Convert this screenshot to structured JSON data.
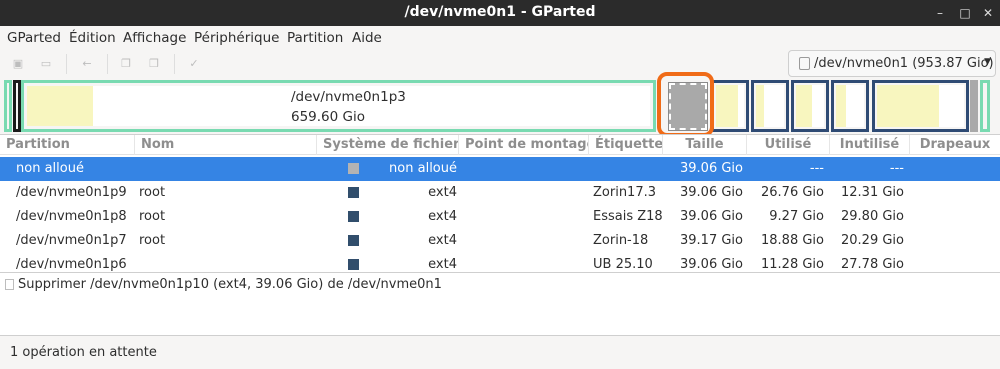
{
  "window": {
    "title": "/dev/nvme0n1 - GParted"
  },
  "menubar": [
    "GParted",
    "Édition",
    "Affichage",
    "Périphérique",
    "Partition",
    "Aide"
  ],
  "device_selector": {
    "label": "/dev/nvme0n1 (953.87 Gio)"
  },
  "partition_map": {
    "selected_name": "/dev/nvme0n1p3",
    "selected_size": "659.60 Gio"
  },
  "table": {
    "columns": [
      "Partition",
      "Nom",
      "Système de fichiers",
      "Point de montage",
      "Étiquette",
      "Taille",
      "Utilisé",
      "Inutilisé",
      "Drapeaux"
    ],
    "rows": [
      {
        "partition": "non alloué",
        "name": "",
        "fs": "non alloué",
        "mount": "",
        "label": "",
        "size": "39.06 Gio",
        "used": "---",
        "unused": "---",
        "flags": "",
        "fs_color": "#a9a9a9"
      },
      {
        "partition": "/dev/nvme0n1p9",
        "name": "root",
        "fs": "ext4",
        "mount": "",
        "label": "Zorin17.3",
        "size": "39.06 Gio",
        "used": "26.76 Gio",
        "unused": "12.31 Gio",
        "flags": "",
        "fs_color": "#314e6c"
      },
      {
        "partition": "/dev/nvme0n1p8",
        "name": "root",
        "fs": "ext4",
        "mount": "",
        "label": "Essais Z18",
        "size": "39.06 Gio",
        "used": "9.27 Gio",
        "unused": "29.80 Gio",
        "flags": "",
        "fs_color": "#314e6c"
      },
      {
        "partition": "/dev/nvme0n1p7",
        "name": "root",
        "fs": "ext4",
        "mount": "",
        "label": "Zorin-18",
        "size": "39.17 Gio",
        "used": "18.88 Gio",
        "unused": "20.29 Gio",
        "flags": "",
        "fs_color": "#314e6c"
      },
      {
        "partition": "/dev/nvme0n1p6",
        "name": "",
        "fs": "ext4",
        "mount": "",
        "label": "UB 25.10",
        "size": "39.06 Gio",
        "used": "11.28 Gio",
        "unused": "27.78 Gio",
        "flags": "",
        "fs_color": "#314e6c"
      }
    ]
  },
  "operations": [
    "Supprimer /dev/nvme0n1p10 (ext4, 39.06 Gio) de /dev/nvme0n1"
  ],
  "status": "1 opération en attente",
  "colors": {
    "selection": "#3584e4",
    "ext4": "#314e6c",
    "unallocated": "#a9a9a9",
    "main_partition_border": "#79dab1",
    "used_space": "#f8f6bf",
    "highlight": "#f06b17"
  }
}
